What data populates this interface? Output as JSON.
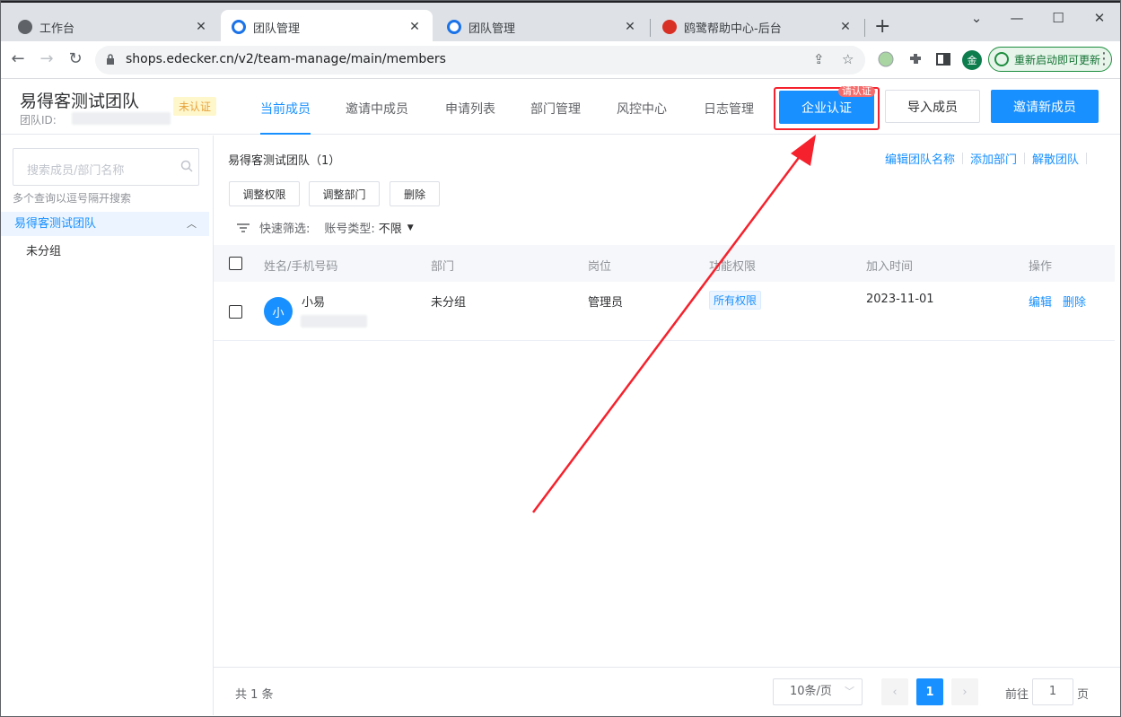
{
  "browser": {
    "tabs": [
      {
        "label": "工作台",
        "active": false
      },
      {
        "label": "团队管理",
        "active": true
      },
      {
        "label": "团队管理",
        "active": false
      },
      {
        "label": "鸥鹭帮助中心-后台",
        "active": false
      }
    ],
    "url": "shops.edecker.cn/v2/team-manage/main/members",
    "update_label": "重新启动即可更新",
    "profile_initial": "金"
  },
  "header": {
    "team_name": "易得客测试团队",
    "team_id_label": "团队ID:",
    "status_badge": "未认证",
    "nav_tabs": [
      "当前成员",
      "邀请中成员",
      "申请列表",
      "部门管理",
      "风控中心",
      "日志管理"
    ],
    "certify_button": "企业认证",
    "certify_badge": "请认证",
    "import_button": "导入成员",
    "invite_button": "邀请新成员"
  },
  "sidebar": {
    "search_placeholder": "搜索成员/部门名称",
    "search_hint": "多个查询以逗号隔开搜索",
    "tree_root": "易得客测试团队",
    "tree_child": "未分组"
  },
  "main": {
    "group_title": "易得客测试团队（1）",
    "links": [
      "编辑团队名称",
      "添加部门",
      "解散团队"
    ],
    "action_buttons": [
      "调整权限",
      "调整部门",
      "删除"
    ],
    "filter_label": "快速筛选:",
    "filter_type_label": "账号类型:",
    "filter_type_value": "不限",
    "columns": [
      "姓名/手机号码",
      "部门",
      "岗位",
      "功能权限",
      "加入时间",
      "操作"
    ],
    "rows": [
      {
        "avatar": "小",
        "name": "小易",
        "department": "未分组",
        "position": "管理员",
        "permission": "所有权限",
        "joined": "2023-11-01",
        "actions": [
          "编辑",
          "删除"
        ]
      }
    ]
  },
  "pagination": {
    "total": "共 1 条",
    "page_size": "10条/页",
    "current_page": "1",
    "goto_prefix": "前往",
    "goto_value": "1",
    "goto_suffix": "页"
  },
  "colors": {
    "primary": "#1890ff",
    "annotation_red": "#f5222d",
    "warning": "#e6a23c"
  }
}
